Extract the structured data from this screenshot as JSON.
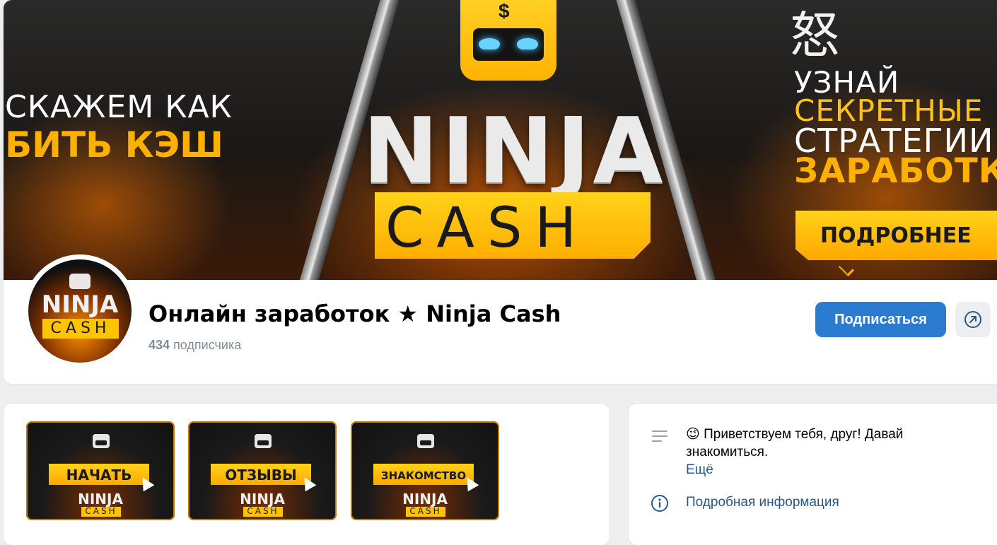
{
  "cover": {
    "left_line_1": "СКАЖЕМ КАК",
    "left_line_2": "БИТЬ КЭШ",
    "logo_word_1": "NINJA",
    "logo_word_2": "CASH",
    "right_line_1": "УЗНАЙ",
    "right_line_2": "СЕКРЕТНЫЕ",
    "right_line_3": "СТРАТЕГИИ",
    "right_line_4": "ЗАРАБОТК",
    "right_button": "ПОДРОБНЕЕ",
    "kanji": "怒",
    "dollar": "$",
    "accent_color": "#ffb000"
  },
  "avatar": {
    "word_1": "NINJA",
    "word_2": "CASH"
  },
  "group": {
    "title": "Онлайн заработок ★ Ninja Cash",
    "subscribers_count": "434",
    "subscribers_label": "подписчика"
  },
  "actions": {
    "subscribe_label": "Подписаться",
    "subscribe_color": "#2b7cd0",
    "more_icon": "share-arrow-icon"
  },
  "widgets": [
    {
      "label": "НАЧАТЬ",
      "brand_1": "NINJA",
      "brand_2": "CASH"
    },
    {
      "label": "ОТЗЫВЫ",
      "brand_1": "NINJA",
      "brand_2": "CASH"
    },
    {
      "label": "ЗНАКОМСТВО",
      "brand_1": "NINJA",
      "brand_2": "CASH"
    }
  ],
  "about": {
    "emoji": "😉",
    "greeting": "Приветствуем тебя, друг! Давай знакомиться.",
    "more_link": "Ещё",
    "details_link": "Подробная информация",
    "link_color": "#2a5885"
  }
}
